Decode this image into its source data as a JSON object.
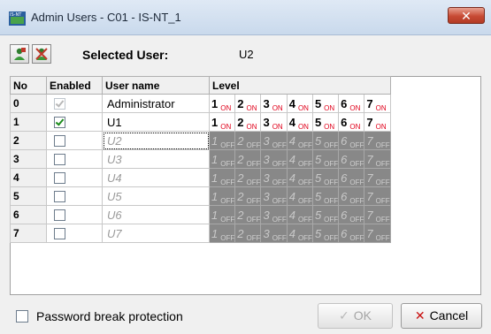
{
  "window": {
    "title": "Admin Users - C01 - IS-NT_1",
    "app_icon_text": "IS-NT",
    "close_glyph": "✕"
  },
  "toolbar": {
    "icons": [
      "add-user-icon",
      "remove-user-icon"
    ],
    "selected_user_label": "Selected User:",
    "selected_user_value": "U2"
  },
  "table": {
    "headers": [
      "No",
      "Enabled",
      "User name",
      "Level"
    ],
    "level_on": "ON",
    "level_off": "OFF",
    "rows": [
      {
        "no": "0",
        "enabled": true,
        "enabled_editable": false,
        "name": "Administrator",
        "active": true,
        "levels": [
          "1",
          "2",
          "3",
          "4",
          "5",
          "6",
          "7"
        ]
      },
      {
        "no": "1",
        "enabled": true,
        "enabled_editable": true,
        "name": "U1",
        "active": true,
        "levels": [
          "1",
          "2",
          "3",
          "4",
          "5",
          "6",
          "7"
        ]
      },
      {
        "no": "2",
        "enabled": false,
        "enabled_editable": true,
        "name": "U2",
        "active": false,
        "levels": [
          "1",
          "2",
          "3",
          "4",
          "5",
          "6",
          "7"
        ]
      },
      {
        "no": "3",
        "enabled": false,
        "enabled_editable": true,
        "name": "U3",
        "active": false,
        "levels": [
          "1",
          "2",
          "3",
          "4",
          "5",
          "6",
          "7"
        ]
      },
      {
        "no": "4",
        "enabled": false,
        "enabled_editable": true,
        "name": "U4",
        "active": false,
        "levels": [
          "1",
          "2",
          "3",
          "4",
          "5",
          "6",
          "7"
        ]
      },
      {
        "no": "5",
        "enabled": false,
        "enabled_editable": true,
        "name": "U5",
        "active": false,
        "levels": [
          "1",
          "2",
          "3",
          "4",
          "5",
          "6",
          "7"
        ]
      },
      {
        "no": "6",
        "enabled": false,
        "enabled_editable": true,
        "name": "U6",
        "active": false,
        "levels": [
          "1",
          "2",
          "3",
          "4",
          "5",
          "6",
          "7"
        ]
      },
      {
        "no": "7",
        "enabled": false,
        "enabled_editable": true,
        "name": "U7",
        "active": false,
        "levels": [
          "1",
          "2",
          "3",
          "4",
          "5",
          "6",
          "7"
        ]
      }
    ]
  },
  "footer": {
    "password_break_label": "Password break protection",
    "password_break_checked": false,
    "ok_label": "OK",
    "ok_enabled": false,
    "cancel_label": "Cancel"
  },
  "colors": {
    "on_state": "#e0001a",
    "off_cell": "#888888",
    "cancel_icon": "#c81010"
  }
}
